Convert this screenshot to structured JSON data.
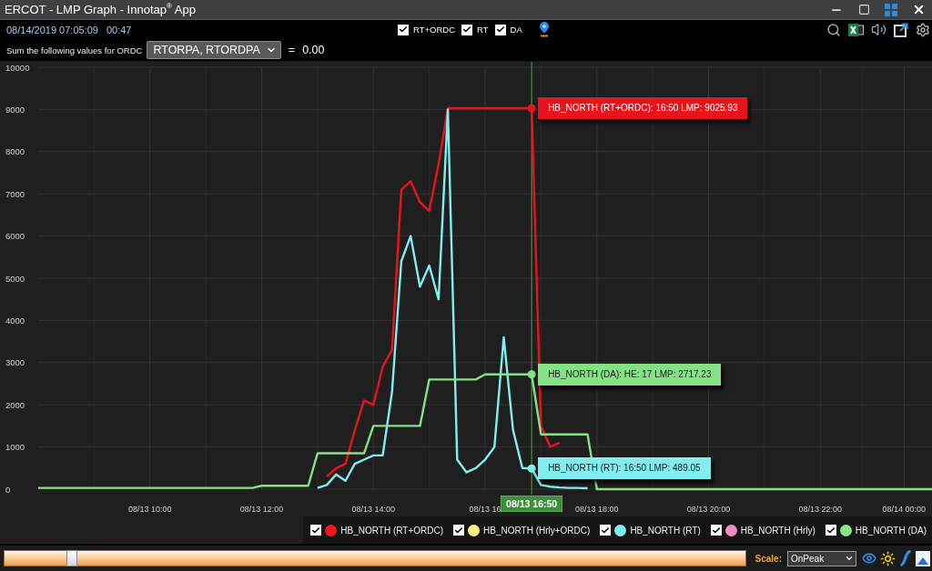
{
  "window": {
    "title": "ERCOT - LMP Graph - Innotap$^{®}$ App"
  },
  "toolbar": {
    "timestamp": "08/14/2019 07:05:09",
    "elapsed": "00:47",
    "filters": [
      {
        "label": "RT+ORDC",
        "checked": true
      },
      {
        "label": "RT",
        "checked": true
      },
      {
        "label": "DA",
        "checked": true
      }
    ]
  },
  "ordc": {
    "label": "Sum the following values for ORDC",
    "selection": "RTORPA, RTORDPA",
    "operator": "=",
    "total": "0.00"
  },
  "chart": {
    "chart_data": {
      "type": "line",
      "grid": true,
      "categories": [
        null,
        null,
        null,
        null,
        null,
        null,
        null,
        null,
        null,
        null,
        null,
        null,
        "08/13 10:00",
        null,
        null,
        null,
        null,
        null,
        null,
        null,
        null,
        null,
        null,
        null,
        "08/13 12:00",
        null,
        null,
        null,
        null,
        null,
        null,
        null,
        null,
        null,
        null,
        null,
        "08/13 14:00",
        null,
        null,
        null,
        null,
        null,
        null,
        null,
        null,
        null,
        null,
        null,
        "08/13 16",
        null,
        null,
        null,
        null,
        "08/13 16:50",
        null,
        null,
        null,
        null,
        null,
        null,
        "08/13 18:00",
        null,
        null,
        null,
        null,
        null,
        null,
        null,
        null,
        null,
        null,
        null,
        "08/13 20:00",
        null,
        null,
        null,
        null,
        null,
        null,
        null,
        null,
        null,
        null,
        null,
        "08/13 22:00",
        null,
        null,
        null,
        null,
        null,
        null,
        null,
        null,
        "08/14 00:00",
        null,
        null,
        null
      ],
      "series": [
        {
          "color": "#e8141c",
          "values": [
            null,
            null,
            null,
            null,
            null,
            null,
            null,
            null,
            null,
            null,
            null,
            null,
            null,
            null,
            null,
            null,
            null,
            null,
            null,
            null,
            null,
            null,
            null,
            null,
            null,
            null,
            null,
            null,
            null,
            null,
            null,
            300,
            500,
            600,
            1400,
            2100,
            2000,
            2900,
            3300,
            7100,
            7300,
            6800,
            6600,
            7700,
            9030,
            9030,
            9030,
            9030,
            9030,
            9030,
            9030,
            9030,
            9030,
            9030,
            1500,
            1000,
            1100,
            null,
            null,
            null,
            null,
            null,
            null,
            null,
            null,
            null,
            null,
            null,
            null,
            null,
            null,
            null,
            null,
            null,
            null,
            null,
            null,
            null,
            null,
            null,
            null,
            null,
            null,
            null,
            null,
            null,
            null,
            null,
            null,
            null,
            null,
            null,
            null,
            null,
            null,
            null,
            null
          ]
        },
        {
          "color": "#80eef0",
          "values": [
            null,
            null,
            null,
            null,
            null,
            null,
            null,
            null,
            null,
            null,
            null,
            null,
            null,
            null,
            null,
            null,
            null,
            null,
            null,
            null,
            null,
            null,
            null,
            null,
            null,
            null,
            null,
            null,
            null,
            null,
            30,
            100,
            350,
            200,
            600,
            700,
            800,
            800,
            2300,
            5400,
            6000,
            4800,
            5300,
            4500,
            9000,
            700,
            400,
            500,
            700,
            1000,
            3600,
            1400,
            500,
            490,
            100,
            60,
            40,
            30,
            30,
            20,
            null,
            null,
            null,
            null,
            null,
            null,
            null,
            null,
            null,
            null,
            null,
            null,
            null,
            null,
            null,
            null,
            null,
            null,
            null,
            null,
            null,
            null,
            null,
            null,
            null,
            null,
            null,
            null,
            null,
            null,
            null,
            null,
            null,
            null,
            null,
            null,
            null
          ]
        },
        {
          "color": "#84e284",
          "values": [
            30,
            30,
            30,
            30,
            30,
            30,
            30,
            30,
            30,
            30,
            30,
            30,
            30,
            30,
            30,
            30,
            30,
            30,
            30,
            30,
            30,
            30,
            30,
            30,
            80,
            80,
            80,
            80,
            80,
            80,
            850,
            850,
            850,
            850,
            850,
            850,
            1500,
            1500,
            1500,
            1500,
            1500,
            1500,
            2600,
            2600,
            2600,
            2600,
            2600,
            2600,
            2720,
            2720,
            2720,
            2720,
            2720,
            2720,
            1300,
            1300,
            1300,
            1300,
            1300,
            1300,
            0,
            0,
            0,
            0,
            0,
            0,
            0,
            0,
            0,
            0,
            0,
            0,
            0,
            0,
            0,
            0,
            0,
            0,
            0,
            0,
            0,
            0,
            0,
            0,
            0,
            0,
            0,
            0,
            0,
            0,
            0,
            0,
            0,
            0,
            0,
            0,
            0
          ]
        }
      ],
      "ylim": [
        0,
        10000
      ],
      "yticks": [
        0,
        1000,
        2000,
        3000,
        4000,
        5000,
        6000,
        7000,
        8000,
        9000,
        10000
      ],
      "annotations": [
        {
          "x": "08/13 16:50"
        },
        {
          "text": "HB_NORTH (RT+ORDC): 16:50 LMP: 9025.93",
          "x": "08/13 16:50",
          "y": 9030
        },
        {
          "text": "HB_NORTH (DA): HE: 17 LMP: 2717.23",
          "x": "08/13 16:50",
          "y": 2720
        },
        {
          "text": "HB_NORTH (RT): 16:50 LMP: 489.05",
          "x": "08/13 16:50",
          "y": 490
        }
      ]
    }
  },
  "legend": [
    {
      "label": "HB_NORTH (RT+ORDC)",
      "color": "#f01818",
      "checked": true
    },
    {
      "label": "HB_NORTH (Hrly+ORDC)",
      "color": "#fff27a",
      "checked": true
    },
    {
      "label": "HB_NORTH (RT)",
      "color": "#80ecf8",
      "checked": true
    },
    {
      "label": "HB_NORTH (Hrly)",
      "color": "#f28cc4",
      "checked": true
    },
    {
      "label": "HB_NORTH (DA)",
      "color": "#86e886",
      "checked": true
    }
  ],
  "footer": {
    "scale_label": "Scale:",
    "scale_value": "OnPeak"
  }
}
